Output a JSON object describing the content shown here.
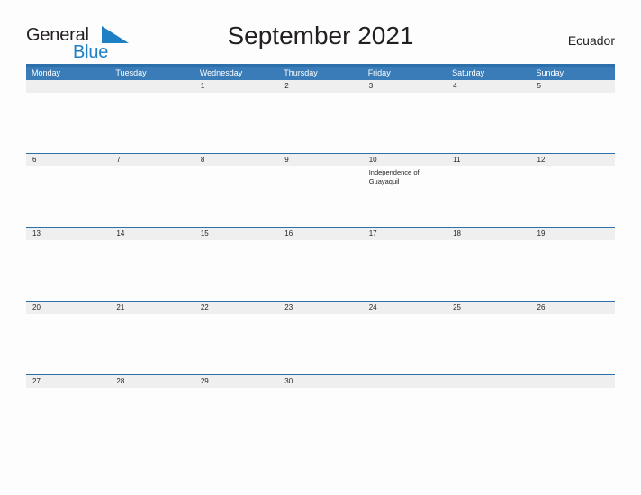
{
  "brand": {
    "name_part1": "General",
    "name_part2": "Blue",
    "flag_icon": "blue-flag-triangle",
    "color": "#1f7fc4"
  },
  "header": {
    "title": "September 2021",
    "country": "Ecuador"
  },
  "colors": {
    "header_blue": "#3a7cb8",
    "rule_blue": "#2b6fab",
    "date_band": "#efefef",
    "page_background": "#fdfdfd",
    "text": "#231f20"
  },
  "calendar": {
    "weekdays": [
      "Monday",
      "Tuesday",
      "Wednesday",
      "Thursday",
      "Friday",
      "Saturday",
      "Sunday"
    ],
    "weeks": [
      {
        "days": [
          {
            "date": "",
            "events": []
          },
          {
            "date": "",
            "events": []
          },
          {
            "date": "1",
            "events": []
          },
          {
            "date": "2",
            "events": []
          },
          {
            "date": "3",
            "events": []
          },
          {
            "date": "4",
            "events": []
          },
          {
            "date": "5",
            "events": []
          }
        ]
      },
      {
        "days": [
          {
            "date": "6",
            "events": []
          },
          {
            "date": "7",
            "events": []
          },
          {
            "date": "8",
            "events": []
          },
          {
            "date": "9",
            "events": []
          },
          {
            "date": "10",
            "events": [
              "Independence of Guayaquil"
            ]
          },
          {
            "date": "11",
            "events": []
          },
          {
            "date": "12",
            "events": []
          }
        ]
      },
      {
        "days": [
          {
            "date": "13",
            "events": []
          },
          {
            "date": "14",
            "events": []
          },
          {
            "date": "15",
            "events": []
          },
          {
            "date": "16",
            "events": []
          },
          {
            "date": "17",
            "events": []
          },
          {
            "date": "18",
            "events": []
          },
          {
            "date": "19",
            "events": []
          }
        ]
      },
      {
        "days": [
          {
            "date": "20",
            "events": []
          },
          {
            "date": "21",
            "events": []
          },
          {
            "date": "22",
            "events": []
          },
          {
            "date": "23",
            "events": []
          },
          {
            "date": "24",
            "events": []
          },
          {
            "date": "25",
            "events": []
          },
          {
            "date": "26",
            "events": []
          }
        ]
      },
      {
        "days": [
          {
            "date": "27",
            "events": []
          },
          {
            "date": "28",
            "events": []
          },
          {
            "date": "29",
            "events": []
          },
          {
            "date": "30",
            "events": []
          },
          {
            "date": "",
            "events": []
          },
          {
            "date": "",
            "events": []
          },
          {
            "date": "",
            "events": []
          }
        ]
      }
    ]
  }
}
